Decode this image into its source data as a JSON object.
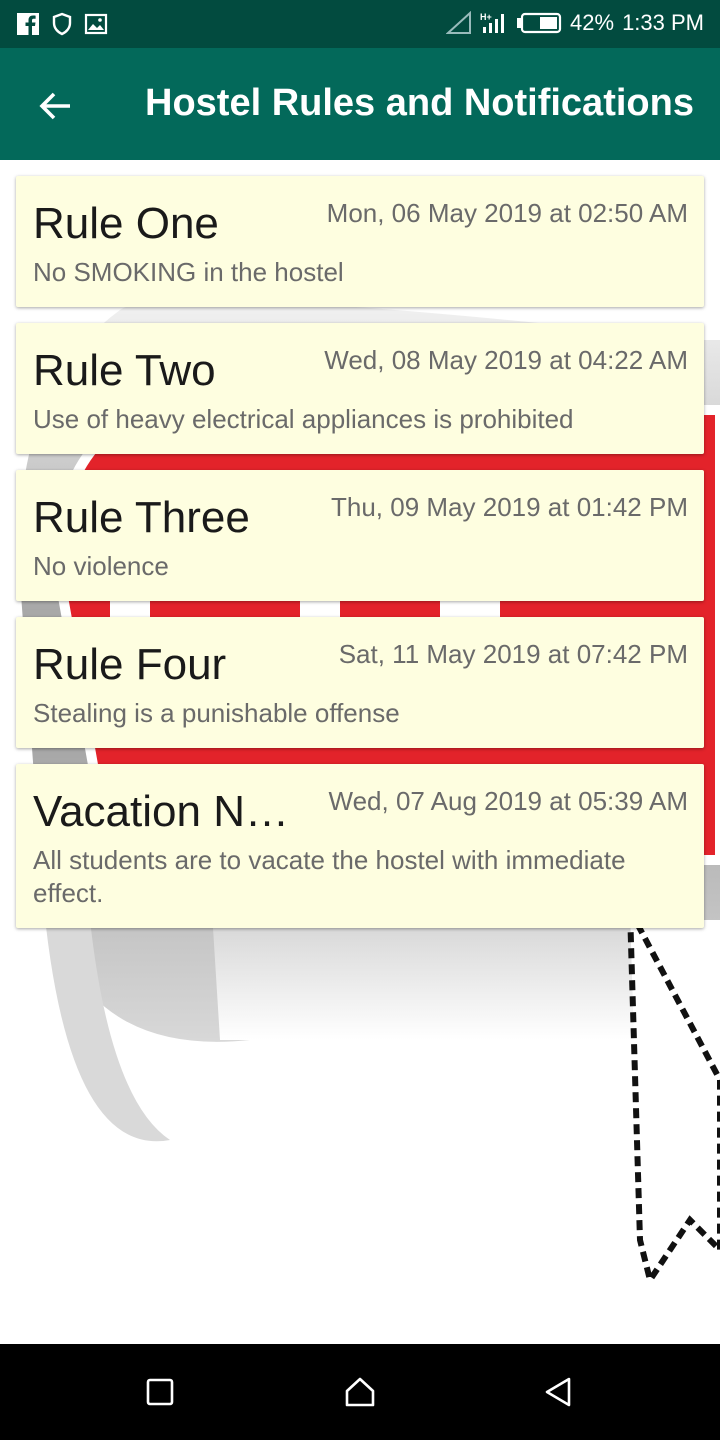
{
  "status_bar": {
    "battery": "42%",
    "time": "1:33 PM",
    "network": "H+",
    "icons": [
      "facebook-icon",
      "shield-icon",
      "image-icon",
      "signal-icon",
      "battery-icon"
    ]
  },
  "appbar": {
    "title": "Hostel Rules and Notifications",
    "back_icon": "arrow-left-icon"
  },
  "notifications": [
    {
      "title": "Rule One",
      "date": "Mon, 06 May 2019 at 02:50 AM",
      "body": "No SMOKING in the hostel"
    },
    {
      "title": "Rule Two",
      "date": "Wed, 08 May 2019 at 04:22 AM",
      "body": "Use of heavy electrical appliances is prohibited"
    },
    {
      "title": "Rule Three",
      "date": "Thu, 09 May 2019 at 01:42 PM",
      "body": "No violence"
    },
    {
      "title": "Rule Four",
      "date": "Sat, 11 May 2019 at 07:42 PM",
      "body": "Stealing is a punishable offense"
    },
    {
      "title": "Vacation Notice",
      "date": "Wed, 07 Aug 2019 at 05:39 AM",
      "body": "All students are to vacate the hostel with immediate effect."
    }
  ],
  "navbar": {
    "icons": [
      "recents-square-icon",
      "home-icon",
      "back-triangle-icon"
    ]
  },
  "colors": {
    "statusbar": "#024b3f",
    "appbar": "#03695a",
    "card": "#fefee0",
    "stop_red": "#e3232a"
  }
}
